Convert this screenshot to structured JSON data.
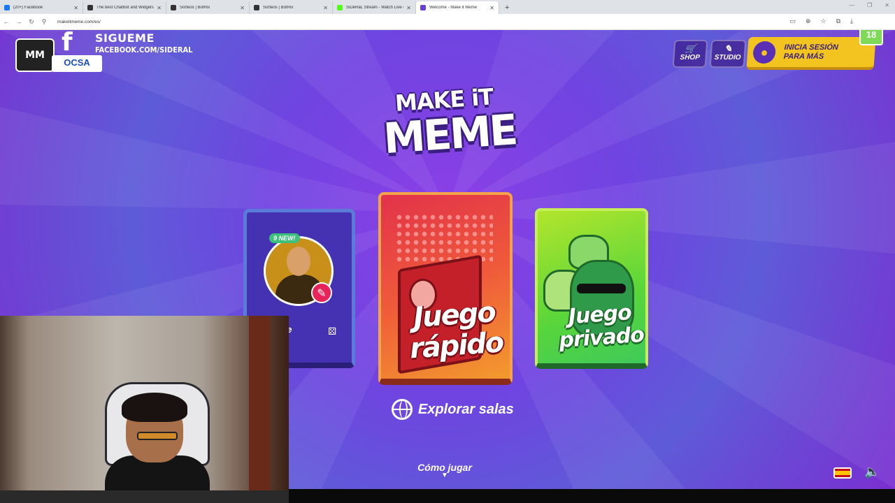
{
  "browser": {
    "tabs": [
      {
        "title": "(20+) Facebook",
        "color": "#1877f2",
        "active": false
      },
      {
        "title": "The best ChatBot and Widgets",
        "color": "#333333",
        "active": false
      },
      {
        "title": "Sorteos | BotRix",
        "color": "#333333",
        "active": false
      },
      {
        "title": "Sorteos | BotRix",
        "color": "#333333",
        "active": false
      },
      {
        "title": "SiDeRaL Stream - Watch Live o",
        "color": "#53fc18",
        "active": false
      },
      {
        "title": "Welcome - Make it Meme",
        "color": "#6a3fd8",
        "active": true
      }
    ],
    "url": "makeitmeme.com/es/"
  },
  "overlay": {
    "follow": "SIGUEME",
    "facebook": "FACEBOOK.COM/SIDERAL",
    "sponsor": "OCSA",
    "age_badge": "18"
  },
  "header": {
    "shop_label": "SHOP",
    "studio_label": "STUDIO",
    "login_line1": "INICIA SESIÓN",
    "login_line2": "PARA MÁS"
  },
  "logo": {
    "line1": "MAKE iT",
    "line2": "MEME"
  },
  "cards": {
    "left_badge": "9 NEW!",
    "left_label": "se",
    "quick_line1": "Juego",
    "quick_line2": "rápido",
    "private_line1": "Juego",
    "private_line2": "privado"
  },
  "explore_label": "Explorar salas",
  "howto_label": "Cómo jugar",
  "colors": {
    "accent": "#6f44e0",
    "login": "#f3c31f",
    "quick": "#ef5a3a",
    "private": "#5ad63a"
  }
}
